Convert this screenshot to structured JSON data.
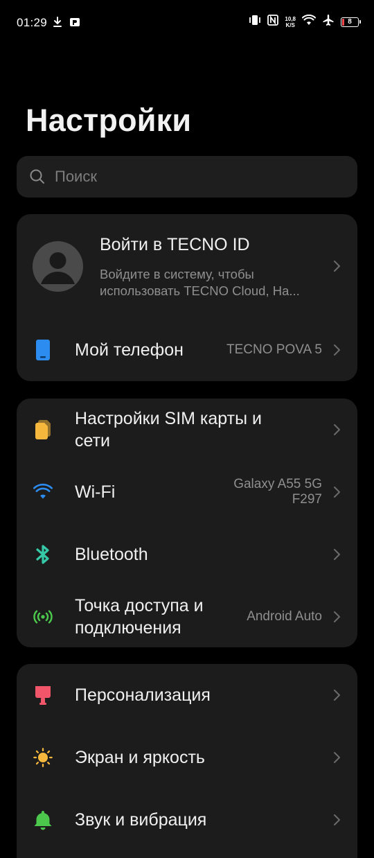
{
  "status_bar": {
    "time": "01:29",
    "net_speed_value": "10,8",
    "net_speed_unit": "K/S",
    "battery_level": "8",
    "battery_color": "#ff4a4a",
    "icons_left": [
      "download-icon",
      "pay-icon"
    ],
    "icons_right": [
      "vibrate-icon",
      "nfc-icon",
      "wifi-icon",
      "airplane-icon",
      "battery-icon"
    ]
  },
  "page": {
    "title": "Настройки"
  },
  "search": {
    "placeholder": "Поиск"
  },
  "account": {
    "title": "Войти в TECNO ID",
    "subtitle_line1": "Войдите в систему, чтобы",
    "subtitle_line2": "использовать TECNO Cloud, На..."
  },
  "my_phone": {
    "label": "Мой телефон",
    "value": "TECNO POVA 5",
    "icon": "phone-icon",
    "icon_color": "#2d8cf0"
  },
  "connectivity": {
    "sim": {
      "label_line1": "Настройки SIM карты и",
      "label_line2": "сети",
      "icon": "sim-card-icon",
      "icon_color": "#f5b83d"
    },
    "wifi": {
      "label": "Wi-Fi",
      "value_line1": "Galaxy A55 5G",
      "value_line2": "F297",
      "icon": "wifi-icon",
      "icon_color": "#2d8cf0"
    },
    "bluetooth": {
      "label": "Bluetooth",
      "icon": "bluetooth-icon",
      "icon_color": "#35c9a8"
    },
    "hotspot": {
      "label_line1": "Точка доступа и",
      "label_line2": "подключения",
      "value": "Android Auto",
      "icon": "hotspot-icon",
      "icon_color": "#4cc94c"
    }
  },
  "display_group": {
    "personalization": {
      "label": "Персонализация",
      "icon": "brush-icon",
      "icon_color": "#f0556a"
    },
    "screen": {
      "label": "Экран и яркость",
      "icon": "sun-icon",
      "icon_color": "#f5b83d"
    },
    "sound": {
      "label": "Звук и вибрация",
      "icon": "bell-icon",
      "icon_color": "#4cc94c"
    }
  }
}
